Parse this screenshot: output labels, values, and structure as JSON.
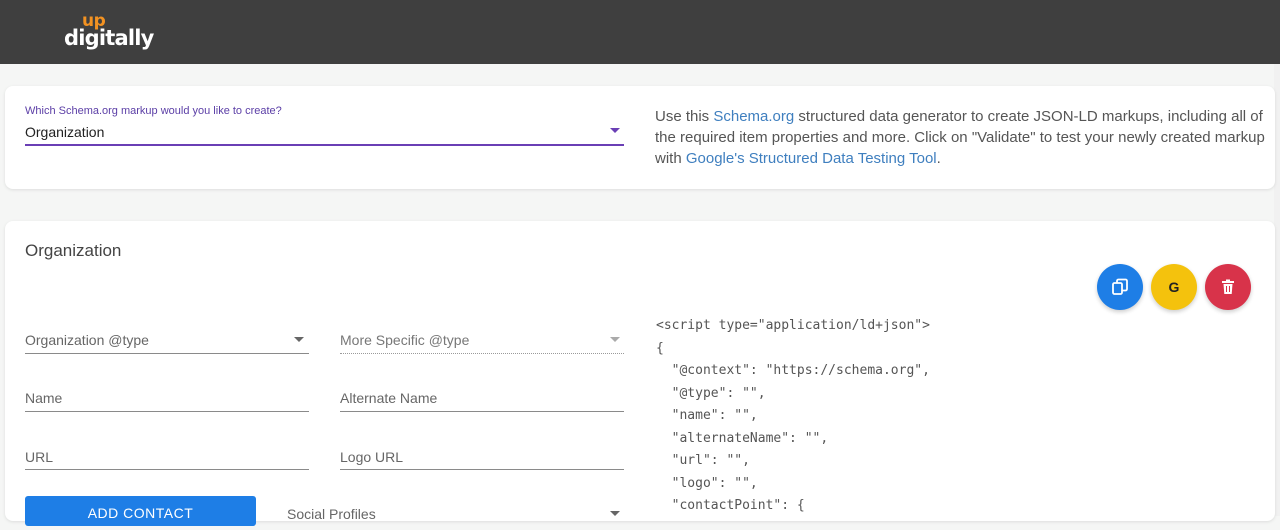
{
  "header": {
    "logo_up": "up",
    "logo_word": "digitally"
  },
  "selector": {
    "label": "Which Schema.org markup would you like to create?",
    "value": "Organization"
  },
  "description": {
    "part1": "Use this ",
    "link1": "Schema.org",
    "part2": " structured data generator to create JSON-LD markups, including all of the required item properties and more. Click on \"Validate\" to test your newly created markup with ",
    "link2": "Google's Structured Data Testing Tool",
    "part3": "."
  },
  "form": {
    "title": "Organization",
    "org_type_label": "Organization @type",
    "more_specific_label": "More Specific @type",
    "name_label": "Name",
    "alt_name_label": "Alternate Name",
    "url_label": "URL",
    "logo_url_label": "Logo URL",
    "add_contact_label": "ADD CONTACT",
    "social_profiles_label": "Social Profiles"
  },
  "actions": {
    "google_label": "G",
    "copy_icon": "copy-icon",
    "delete_icon": "trash-icon",
    "colors": {
      "copy": "#1e7ee6",
      "google": "#f4c20d",
      "delete": "#d8334a"
    }
  },
  "code": {
    "lines": [
      "<script type=\"application/ld+json\">",
      "{",
      "  \"@context\": \"https://schema.org\",",
      "  \"@type\": \"\",",
      "  \"name\": \"\",",
      "  \"alternateName\": \"\",",
      "  \"url\": \"\",",
      "  \"logo\": \"\",",
      "  \"contactPoint\": {"
    ]
  },
  "colors": {
    "topbar": "#3f3f3f",
    "accent_purple": "#6a3fb5",
    "link_blue": "#3f7fbf",
    "logo_orange": "#f29222"
  }
}
